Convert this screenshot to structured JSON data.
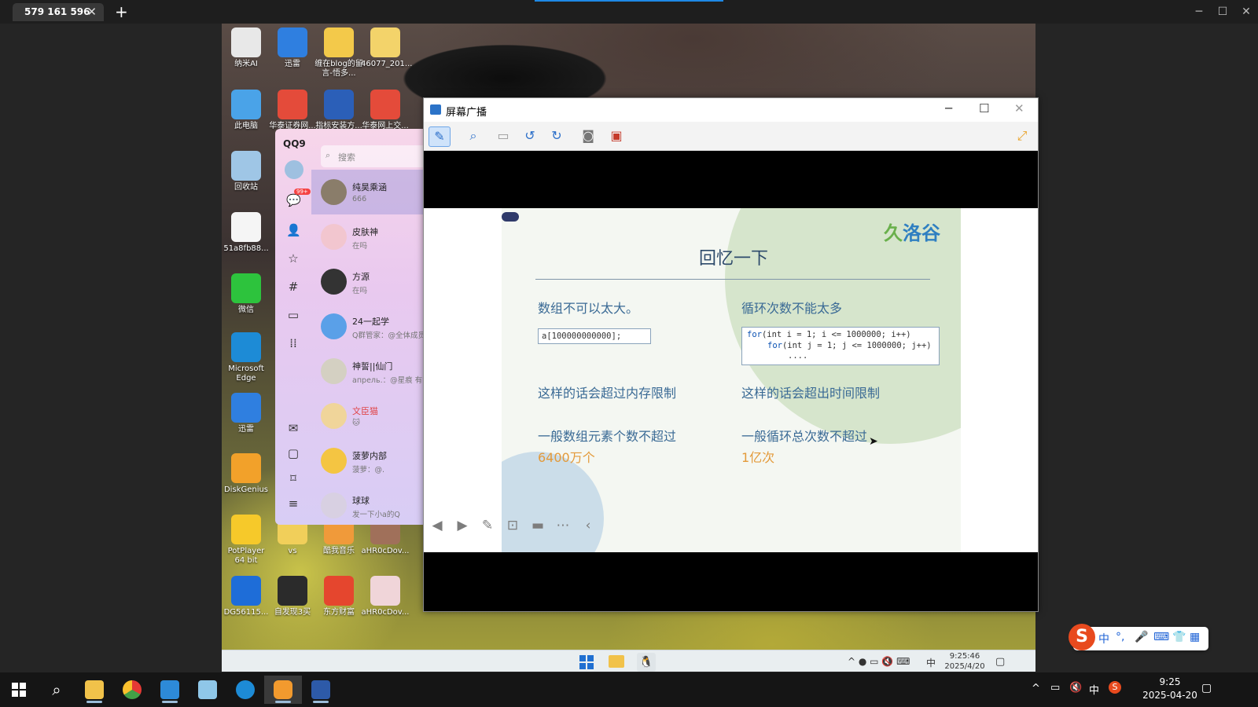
{
  "viewer": {
    "tab_title": "579 161 596",
    "tab_close": "✕",
    "new_tab": "+"
  },
  "desktop_icons": [
    {
      "label": "纳米AI",
      "color": "#e8e8e8"
    },
    {
      "label": "迅雷",
      "color": "#2f7fe0"
    },
    {
      "label": "缠在blog的留言-悟多...",
      "color": "#f3c94a"
    },
    {
      "label": "46077_201...",
      "color": "#f3d36a"
    },
    {
      "label": "此电脑",
      "color": "#4aa3e8"
    },
    {
      "label": "华泰证券网...",
      "color": "#e44b3a"
    },
    {
      "label": "指标安装方...",
      "color": "#2b5fb8"
    },
    {
      "label": "华泰网上交...",
      "color": "#e44b3a"
    },
    {
      "label": "回收站",
      "color": "#9fc6e6"
    },
    {
      "label": "51a8fb88...",
      "color": "#f5f5f5"
    },
    {
      "label": "微信",
      "color": "#2dc33d"
    },
    {
      "label": "Microsoft Edge",
      "color": "#1d8bd6"
    },
    {
      "label": "迅雷",
      "color": "#2f7fe0"
    },
    {
      "label": "DiskGenius",
      "color": "#f2a12a"
    },
    {
      "label": "PotPlayer 64 bit",
      "color": "#f6c92a"
    },
    {
      "label": "vs",
      "color": "#f1cf5a"
    },
    {
      "label": "酷我音乐",
      "color": "#f09a3a"
    },
    {
      "label": "aHR0cDov...",
      "color": "#a0705a"
    },
    {
      "label": "DG56115...",
      "color": "#1e6dd8"
    },
    {
      "label": "自发现3买",
      "color": "#2b2b2b"
    },
    {
      "label": "东方财富",
      "color": "#e5462e"
    },
    {
      "label": "aHR0cDov...",
      "color": "#f0d5d9"
    }
  ],
  "qq": {
    "logo": "QQ9",
    "search_placeholder": "搜索",
    "badge": "99+",
    "contacts": [
      {
        "name": "纯昊乘涵",
        "sub": "666",
        "color": "#8a7d6a",
        "highlight": true
      },
      {
        "name": "皮肤神",
        "sub": "在吗",
        "color": "#f2c6cf"
      },
      {
        "name": "方源",
        "sub": "在吗",
        "color": "#333333"
      },
      {
        "name": "24一起学",
        "sub": "Q群管家：@全体成员",
        "color": "#5aa0e8"
      },
      {
        "name": "神誓||仙门",
        "sub": "апрель.：@星痕 有的",
        "color": "#d4d0c2"
      },
      {
        "name": "文臣猫",
        "sub": "🐱",
        "color": "#f0d59a",
        "red": true
      },
      {
        "name": "菠萝内部",
        "sub": "菠萝：@.",
        "color": "#f4c542"
      },
      {
        "name": "球球",
        "sub": "发一下小a的Q",
        "color": "#d8d0e2"
      }
    ]
  },
  "broadcast": {
    "title": "屏幕广播",
    "minimize": "─",
    "maximize": "☐",
    "close": "✕"
  },
  "slide": {
    "logo_prefix": "久",
    "logo_text": "洛谷",
    "title": "回忆一下",
    "left_heading": "数组不可以太大。",
    "left_code": "a[100000000000];",
    "right_heading": "循环次数不能太多",
    "right_code_line1_kw": "for",
    "right_code_line1": "(int i = 1; i <= 1000000; i++)",
    "right_code_line2_kw": "for",
    "right_code_line2": "(int j = 1; j <= 1000000; j++)",
    "right_code_line3": "....",
    "left_mid": "这样的话会超过内存限制",
    "right_mid": "这样的话会超出时间限制",
    "left_bottom": "一般数组元素个数不超过",
    "left_bottom_value": "6400万个",
    "right_bottom": "一般循环总次数不超过",
    "right_bottom_value": "1亿次"
  },
  "remote_tray": {
    "ime": "中",
    "time": "9:25:46",
    "date": "2025/4/20"
  },
  "taskbar": {
    "time": "9:25",
    "date": "2025-04-20",
    "ime": "中"
  },
  "ime_bar": {
    "logo": "S",
    "lang": "中",
    "punct": "°,"
  }
}
